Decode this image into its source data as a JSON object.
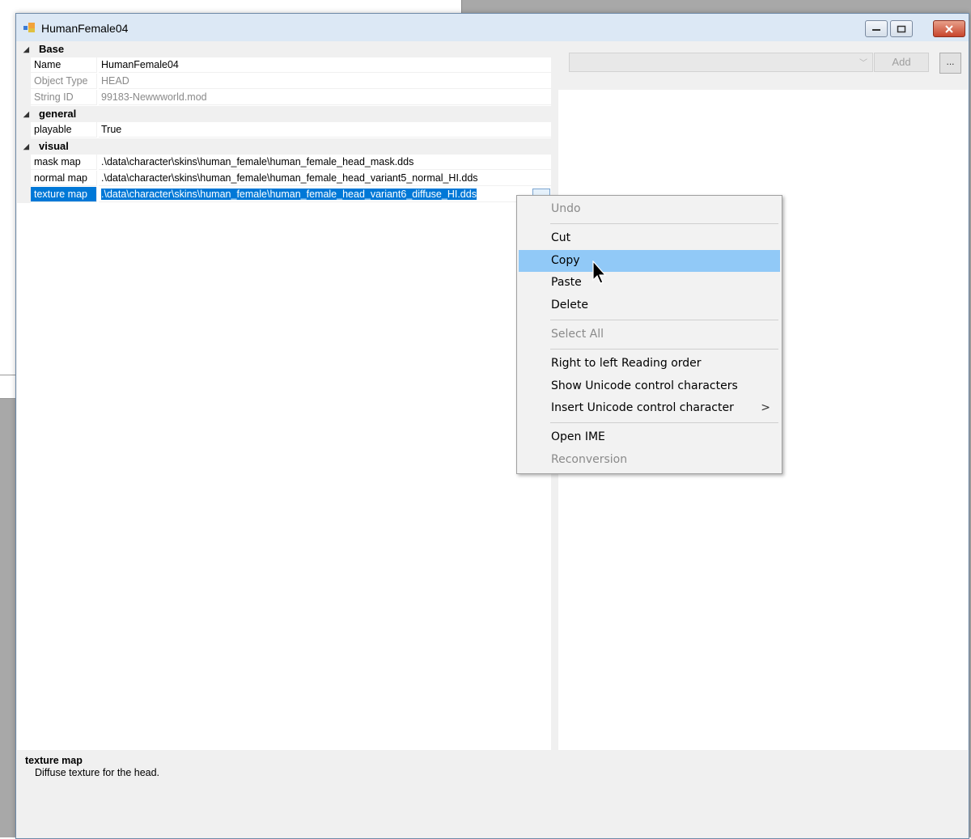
{
  "window": {
    "title": "HumanFemale04",
    "controls": {
      "minimize": "minimize",
      "maximize": "maximize",
      "close": "close"
    }
  },
  "categories": {
    "base": "Base",
    "general": "general",
    "visual": "visual"
  },
  "properties": {
    "name": {
      "label": "Name",
      "value": "HumanFemale04"
    },
    "object_type": {
      "label": "Object Type",
      "value": "HEAD"
    },
    "string_id": {
      "label": "String ID",
      "value": "99183-Newwworld.mod"
    },
    "playable": {
      "label": "playable",
      "value": "True"
    },
    "mask_map": {
      "label": "mask map",
      "value": ".\\data\\character\\skins\\human_female\\human_female_head_mask.dds"
    },
    "normal_map": {
      "label": "normal map",
      "value": ".\\data\\character\\skins\\human_female\\human_female_head_variant5_normal_HI.dds"
    },
    "texture_map": {
      "label": "texture map",
      "value": ".\\data\\character\\skins\\human_female\\human_female_head_variant6_diffuse_HI.dds"
    }
  },
  "value_button": "...",
  "right_pane": {
    "add_label": "Add",
    "more_label": "..."
  },
  "description": {
    "title": "texture map",
    "text": "Diffuse texture for the head."
  },
  "context_menu": {
    "undo": "Undo",
    "cut": "Cut",
    "copy": "Copy",
    "paste": "Paste",
    "delete": "Delete",
    "select_all": "Select All",
    "rtl": "Right to left Reading order",
    "show_unicode": "Show Unicode control characters",
    "insert_unicode": "Insert Unicode control character",
    "submenu_arrow": ">",
    "open_ime": "Open IME",
    "reconversion": "Reconversion"
  },
  "colors": {
    "selection": "#0078d7",
    "menu_highlight": "#91c9f7",
    "title_bar": "#dce8f5"
  }
}
